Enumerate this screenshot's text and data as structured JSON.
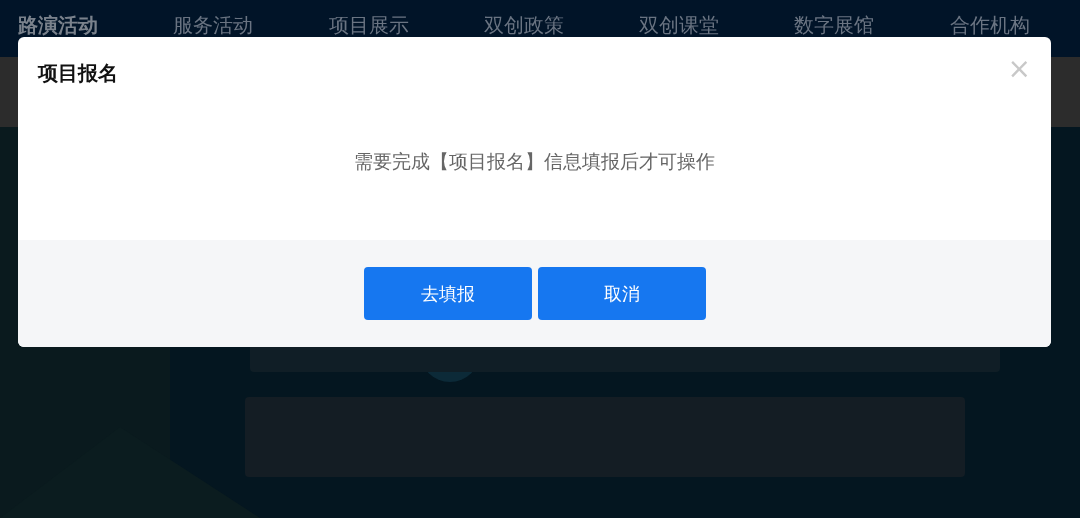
{
  "nav": [
    {
      "label": "路演活动",
      "selected": true
    },
    {
      "label": "服务活动",
      "selected": false
    },
    {
      "label": "项目展示",
      "selected": false
    },
    {
      "label": "双创政策",
      "selected": false
    },
    {
      "label": "双创课堂",
      "selected": false
    },
    {
      "label": "数字展馆",
      "selected": false
    },
    {
      "label": "合作机构",
      "selected": false
    }
  ],
  "dialog": {
    "title": "项目报名",
    "close": "×",
    "message": "需要完成【项目报名】信息填报后才可操作",
    "buttons": [
      "去填报",
      "取消"
    ]
  }
}
